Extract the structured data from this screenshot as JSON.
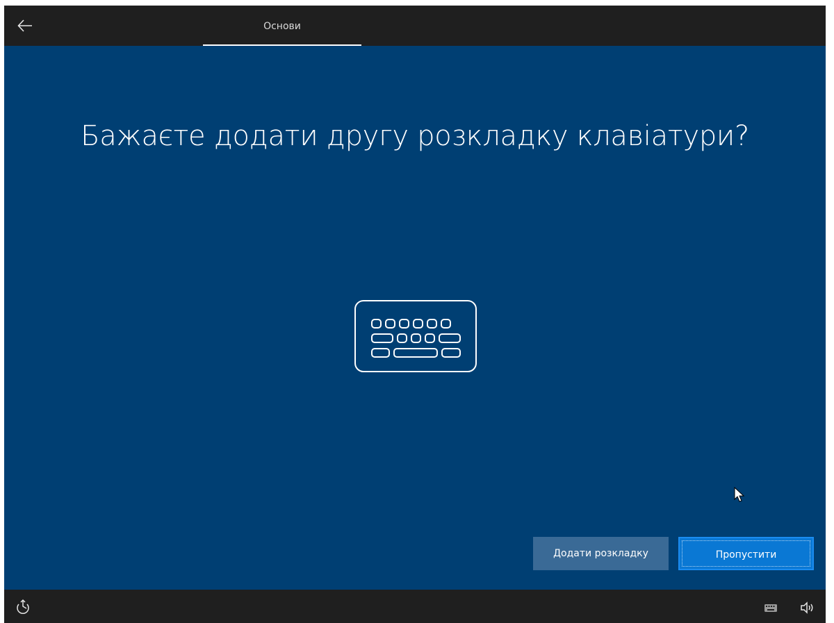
{
  "header": {
    "back_icon": "back-arrow-icon",
    "tab_label": "Основи"
  },
  "main": {
    "heading": "Бажаєте додати другу розкладку клавіатури?",
    "illustration_icon": "keyboard-icon"
  },
  "actions": {
    "add_layout_label": "Додати розкладку",
    "skip_label": "Пропустити"
  },
  "footer": {
    "ease_of_access_icon": "ease-of-access-icon",
    "keyboard_icon": "keyboard-icon",
    "volume_icon": "volume-icon"
  },
  "colors": {
    "background": "#003f73",
    "bar": "#1f1f1f",
    "primary_button": "#0a78d4",
    "secondary_button": "#3a6a96"
  }
}
